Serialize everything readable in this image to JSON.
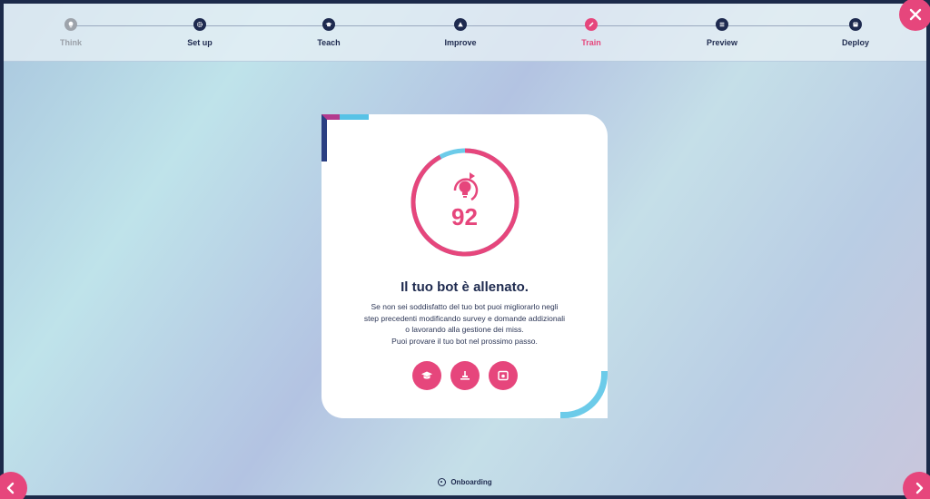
{
  "stepper": {
    "steps": [
      {
        "label": "Think",
        "state": "done",
        "icon": "think-icon"
      },
      {
        "label": "Set up",
        "state": "default",
        "icon": "gear-icon"
      },
      {
        "label": "Teach",
        "state": "default",
        "icon": "graduation-cap-icon"
      },
      {
        "label": "Improve",
        "state": "default",
        "icon": "improve-icon"
      },
      {
        "label": "Train",
        "state": "active",
        "icon": "pencil-icon"
      },
      {
        "label": "Preview",
        "state": "default",
        "icon": "preview-icon"
      },
      {
        "label": "Deploy",
        "state": "default",
        "icon": "deploy-icon"
      }
    ]
  },
  "card": {
    "score": "92",
    "score_fraction": 0.92,
    "title": "Il tuo bot è allenato.",
    "description_lines": [
      "Se non sei soddisfatto del tuo bot puoi migliorarlo negli",
      "step precedenti modificando survey e domande addizionali",
      "o lavorando alla gestione dei miss.",
      "Puoi provare il tuo bot nel prossimo passo."
    ],
    "actions": [
      "teach-icon",
      "train-icon",
      "preview-icon"
    ]
  },
  "footer": {
    "label": "Onboarding",
    "icon": "target-icon"
  },
  "colors": {
    "accent": "#e6467c",
    "navy": "#1e2a4f",
    "cyan": "#6ccbe9",
    "muted": "#9aa0a8"
  }
}
